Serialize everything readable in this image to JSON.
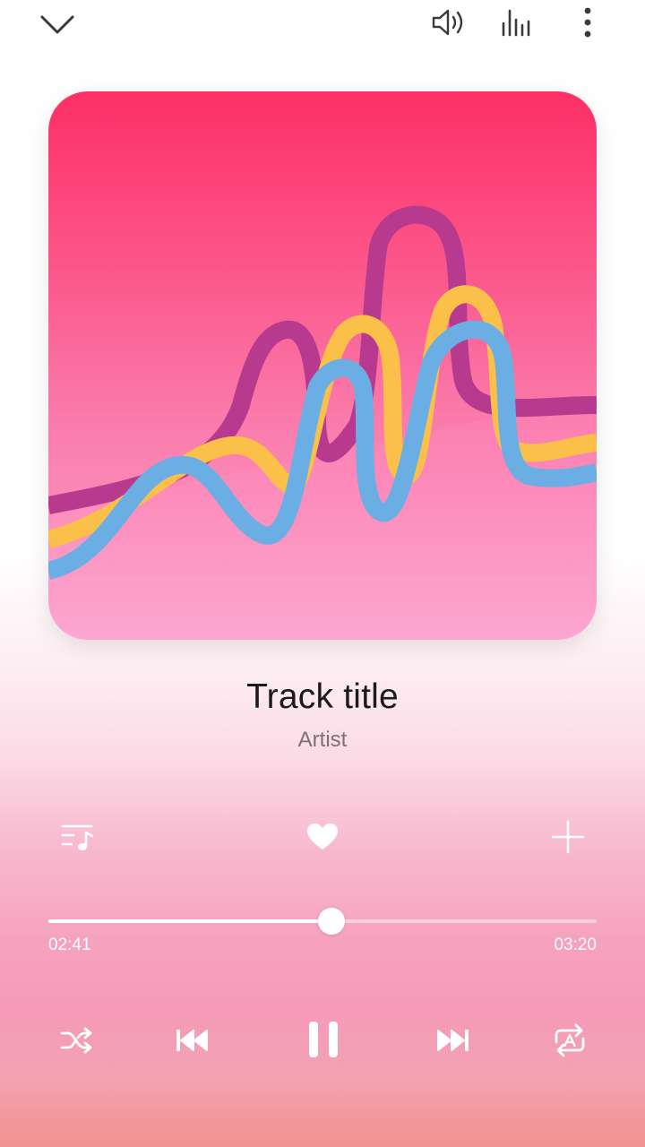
{
  "track": {
    "title": "Track title",
    "artist": "Artist"
  },
  "playback": {
    "elapsed": "02:41",
    "total": "03:20",
    "progress_fraction": 0.517,
    "state": "playing"
  },
  "icons": {
    "collapse": "chevron-down-icon",
    "volume": "volume-icon",
    "equalizer": "equalizer-icon",
    "more": "more-vertical-icon",
    "playlist": "playlist-icon",
    "favorite": "heart-icon",
    "add": "plus-icon",
    "shuffle": "shuffle-icon",
    "previous": "skip-previous-icon",
    "pause": "pause-icon",
    "next": "skip-next-icon",
    "repeat": "repeat-all-icon"
  },
  "colors": {
    "accent": "#ffffff",
    "title_text": "#1b1b1b",
    "artist_text": "#7a7276",
    "background_bottom": "#f59ab9"
  }
}
